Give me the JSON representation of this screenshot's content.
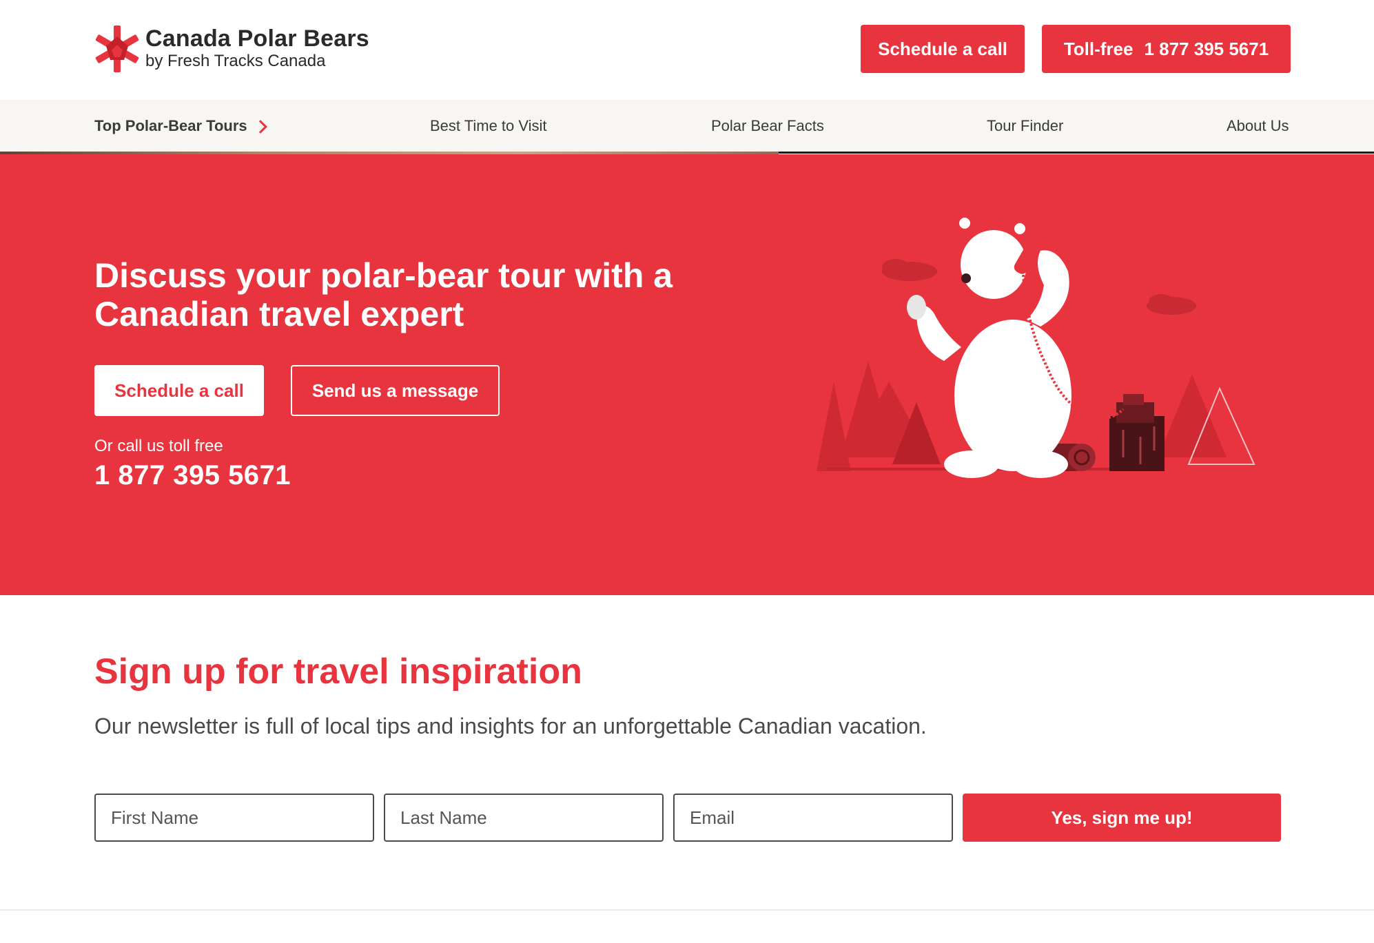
{
  "header": {
    "brand_title": "Canada Polar Bears",
    "brand_subtitle": "by Fresh Tracks Canada",
    "schedule_label": "Schedule a call",
    "tollfree_label": "Toll-free",
    "tollfree_number": "1 877 395 5671"
  },
  "nav": {
    "items": [
      {
        "label": "Top Polar-Bear Tours"
      },
      {
        "label": "Best Time to Visit"
      },
      {
        "label": "Polar Bear Facts"
      },
      {
        "label": "Tour Finder"
      },
      {
        "label": "About Us"
      }
    ]
  },
  "hero": {
    "title": "Discuss your polar-bear tour with a Canadian travel expert",
    "schedule_label": "Schedule a call",
    "message_label": "Send us a message",
    "or_call": "Or call us toll free",
    "phone": "1 877 395 5671"
  },
  "newsletter": {
    "title": "Sign up for travel inspiration",
    "subtitle": "Our newsletter is full of local tips and insights for an unforgettable Canadian vacation.",
    "first_name_placeholder": "First Name",
    "last_name_placeholder": "Last Name",
    "email_placeholder": "Email",
    "submit_label": "Yes, sign me up!"
  },
  "colors": {
    "brand_red": "#e8343e",
    "nav_bg": "#f7f6f3",
    "text_dark": "#2a2a2a"
  },
  "icons": [
    "maple-star-logo-icon",
    "chevron-right-icon",
    "polar-bear-phone-illustration"
  ]
}
